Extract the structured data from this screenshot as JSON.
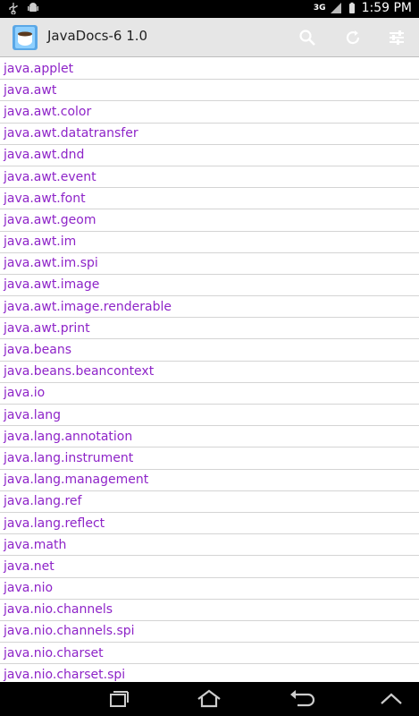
{
  "status": {
    "network": "3G",
    "time": "1:59 PM"
  },
  "actionbar": {
    "title": "JavaDocs-6 1.0",
    "search_icon": "search-icon",
    "refresh_icon": "refresh-icon",
    "settings_icon": "settings-sliders-icon"
  },
  "packages": [
    "java.applet",
    "java.awt",
    "java.awt.color",
    "java.awt.datatransfer",
    "java.awt.dnd",
    "java.awt.event",
    "java.awt.font",
    "java.awt.geom",
    "java.awt.im",
    "java.awt.im.spi",
    "java.awt.image",
    "java.awt.image.renderable",
    "java.awt.print",
    "java.beans",
    "java.beans.beancontext",
    "java.io",
    "java.lang",
    "java.lang.annotation",
    "java.lang.instrument",
    "java.lang.management",
    "java.lang.ref",
    "java.lang.reflect",
    "java.math",
    "java.net",
    "java.nio",
    "java.nio.channels",
    "java.nio.channels.spi",
    "java.nio.charset",
    "java.nio.charset.spi"
  ],
  "colors": {
    "link": "#8e24c8",
    "actionbar": "#e6e6e6"
  }
}
